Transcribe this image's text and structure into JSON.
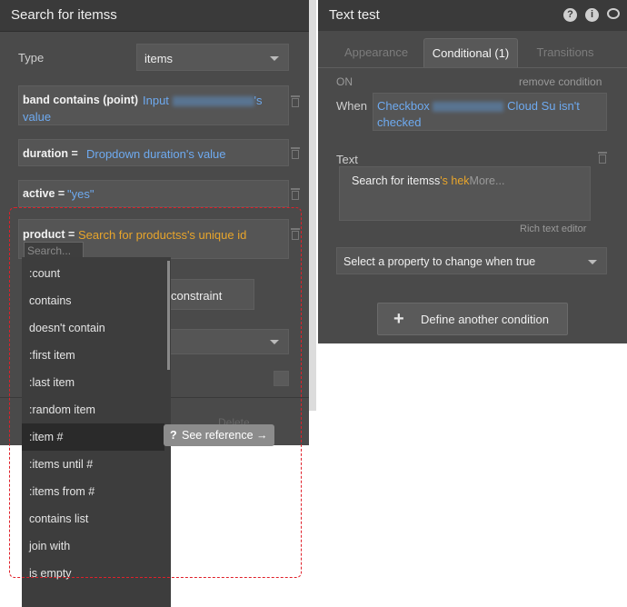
{
  "left": {
    "title": "Search for itemss",
    "type_label": "Type",
    "type_value": "items",
    "c1": {
      "key": "band contains (point)",
      "prefix": "Input",
      "suffix": "'s",
      "tail": "value"
    },
    "c2": {
      "key": "duration =",
      "value": "Dropdown duration's value"
    },
    "c3": {
      "key": "active =",
      "value": "\"yes\""
    },
    "c4": {
      "key": "product =",
      "value": "Search for productss's unique id"
    },
    "search_placeholder": "Search...",
    "add_constraint": "constraint",
    "delete_label": "Delete",
    "see_reference": "See reference →",
    "dropdown_items": [
      ":count",
      "contains",
      "doesn't contain",
      ":first item",
      ":last item",
      ":random item",
      ":item #",
      ":items until #",
      ":items from #",
      "contains list",
      "join with",
      "is empty"
    ],
    "selected_index": 6
  },
  "right": {
    "title": "Text test",
    "tabs": [
      "Appearance",
      "Conditional (1)",
      "Transitions"
    ],
    "on_label": "ON",
    "remove_condition": "remove condition",
    "when_label": "When",
    "when_expr_prefix": "Checkbox",
    "when_expr_suffix": "Cloud Su isn't",
    "when_expr_tail": "checked",
    "text_label": "Text",
    "text_value_plain": "Search for itemss",
    "text_value_orange": "'s hek",
    "text_value_more": "More...",
    "rich_text_editor": "Rich text editor",
    "property_select": "Select a property to change when true",
    "define_condition": "Define another condition"
  },
  "colors": {
    "accent_blue": "#6eaaf0",
    "accent_orange": "#e8a52b",
    "highlight_red": "#e0202a"
  }
}
